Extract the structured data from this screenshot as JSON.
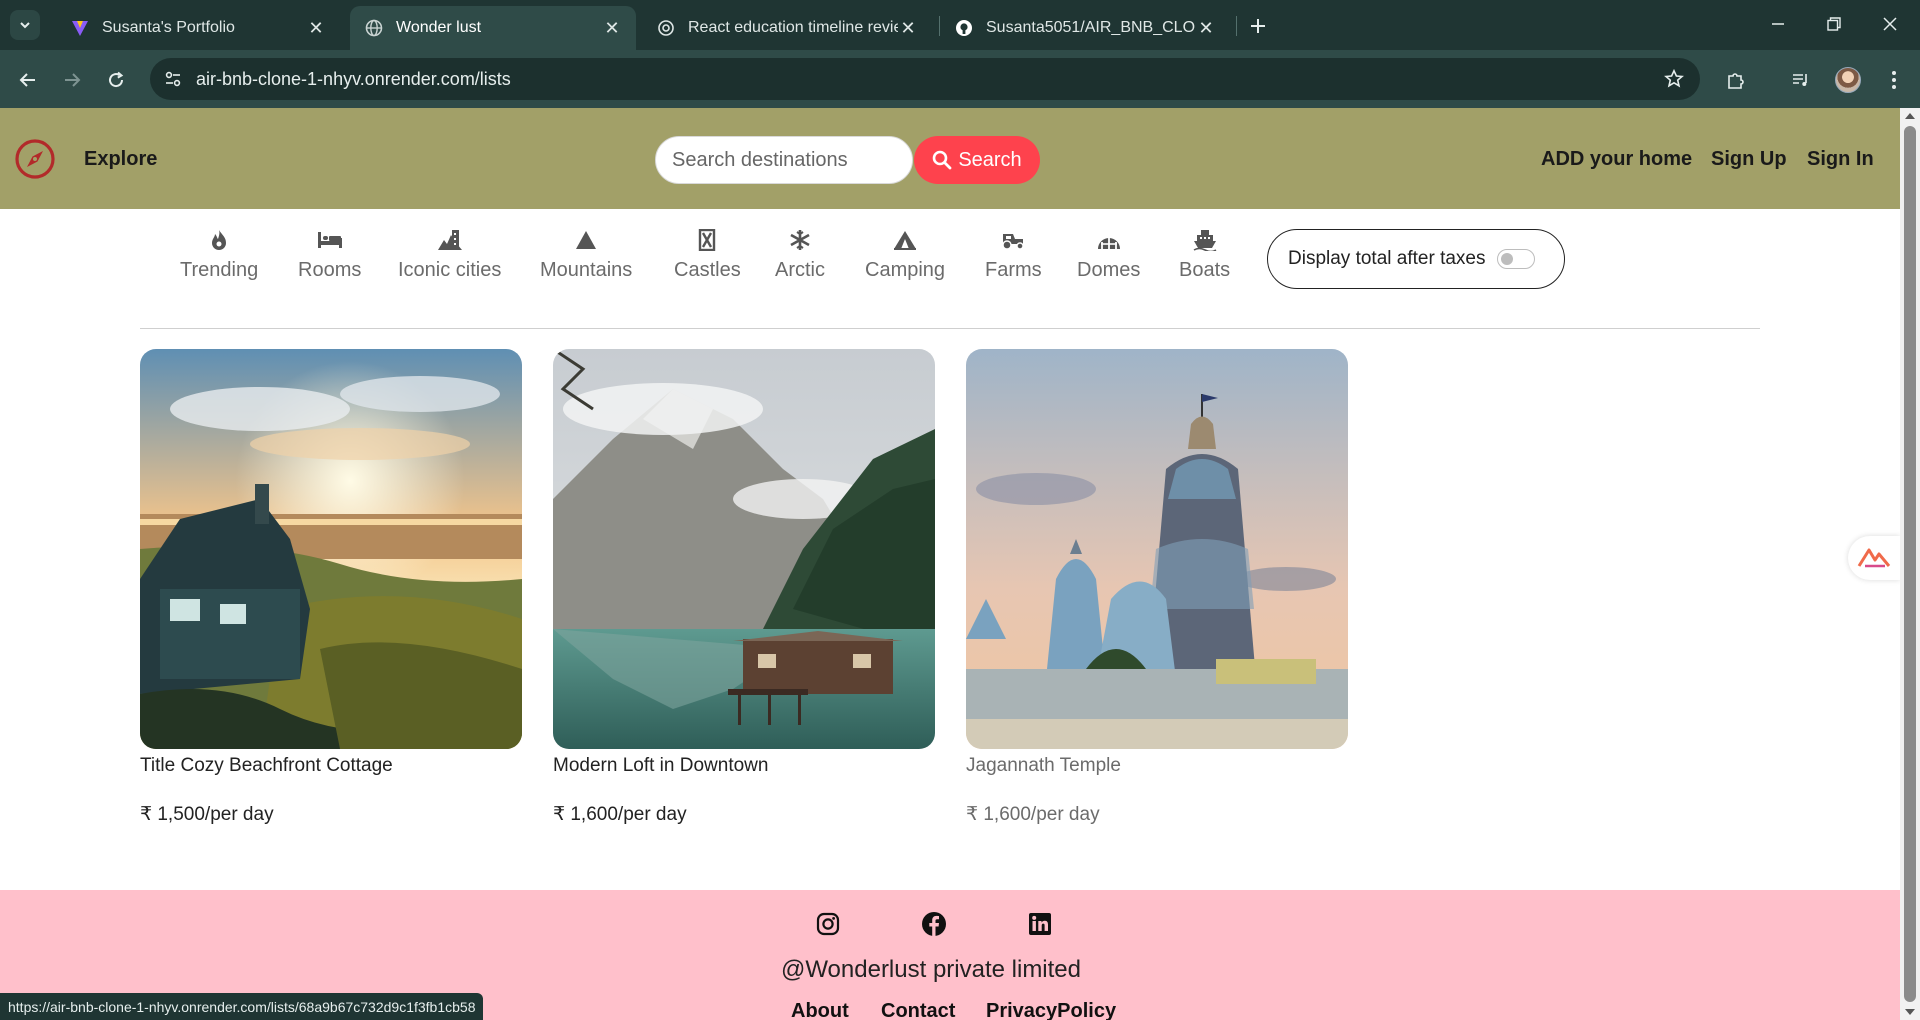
{
  "browser": {
    "tabs": [
      {
        "title": "Susanta's Portfolio"
      },
      {
        "title": "Wonder lust"
      },
      {
        "title": "React education timeline review"
      },
      {
        "title": "Susanta5051/AIR_BNB_CLONE:"
      }
    ],
    "url": "air-bnb-clone-1-nhyv.onrender.com/lists",
    "status_url": "https://air-bnb-clone-1-nhyv.onrender.com/lists/68a9b67c732d9c1f3fb1cb58"
  },
  "nav": {
    "explore": "Explore",
    "search_placeholder": "Search destinations",
    "search_button": "Search",
    "add_home": "ADD your home",
    "sign_up": "Sign Up",
    "sign_in": "Sign In"
  },
  "filters": [
    {
      "label": "Trending",
      "icon": "fire-icon"
    },
    {
      "label": "Rooms",
      "icon": "bed-icon"
    },
    {
      "label": "Iconic cities",
      "icon": "city-icon"
    },
    {
      "label": "Mountains",
      "icon": "mountain-icon"
    },
    {
      "label": "Castles",
      "icon": "castle-icon"
    },
    {
      "label": "Arctic",
      "icon": "snowflake-icon"
    },
    {
      "label": "Camping",
      "icon": "tent-icon"
    },
    {
      "label": "Farms",
      "icon": "tractor-icon"
    },
    {
      "label": "Domes",
      "icon": "dome-icon"
    },
    {
      "label": "Boats",
      "icon": "ship-icon"
    }
  ],
  "tax_toggle": {
    "label": "Display total after taxes",
    "on": false
  },
  "listings": [
    {
      "title": "Title Cozy Beachfront Cottage",
      "price": "₹ 1,500/per day"
    },
    {
      "title": "Modern Loft in Downtown",
      "price": "₹ 1,600/per day"
    },
    {
      "title": "Jagannath Temple",
      "price": "₹ 1,600/per day"
    }
  ],
  "footer": {
    "copyright": "@Wonderlust private limited",
    "links": [
      "About",
      "Contact",
      "PrivacyPolicy"
    ],
    "social": [
      "instagram-icon",
      "facebook-icon",
      "linkedin-icon"
    ]
  },
  "colors": {
    "nav_bg": "#a2a068",
    "search_button": "#fe424d",
    "footer_bg": "#ffc0cb",
    "browser_frame": "#1f3533"
  }
}
